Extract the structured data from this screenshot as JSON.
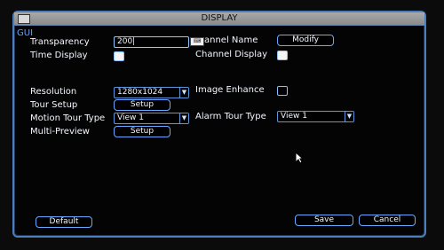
{
  "window": {
    "title": "DISPLAY"
  },
  "section": {
    "gui": "GUI"
  },
  "labels": {
    "transparency": "Transparency",
    "time_display": "Time Display",
    "channel_name": "annel Name",
    "channel_display": "Channel Display",
    "resolution": "Resolution",
    "image_enhance": "Image Enhance",
    "tour_setup": "Tour Setup",
    "motion_tour_type": "Motion Tour Type",
    "alarm_tour_type": "Alarm Tour Type",
    "multi_preview": "Multi-Preview"
  },
  "values": {
    "transparency": "200|",
    "resolution": "1280x1024",
    "motion_tour_type": "View 1",
    "alarm_tour_type": "View 1"
  },
  "buttons": {
    "modify": "Modify",
    "setup": "Setup",
    "default": "Default",
    "save": "Save",
    "cancel": "Cancel"
  },
  "icons": {
    "window": "window-icon",
    "keyboard": "keyboard-icon",
    "cursor": "mouse-pointer-icon",
    "dropdown": "chevron-down-icon"
  },
  "checkboxes": {
    "time_display": true,
    "channel_display": true,
    "image_enhance": false
  }
}
